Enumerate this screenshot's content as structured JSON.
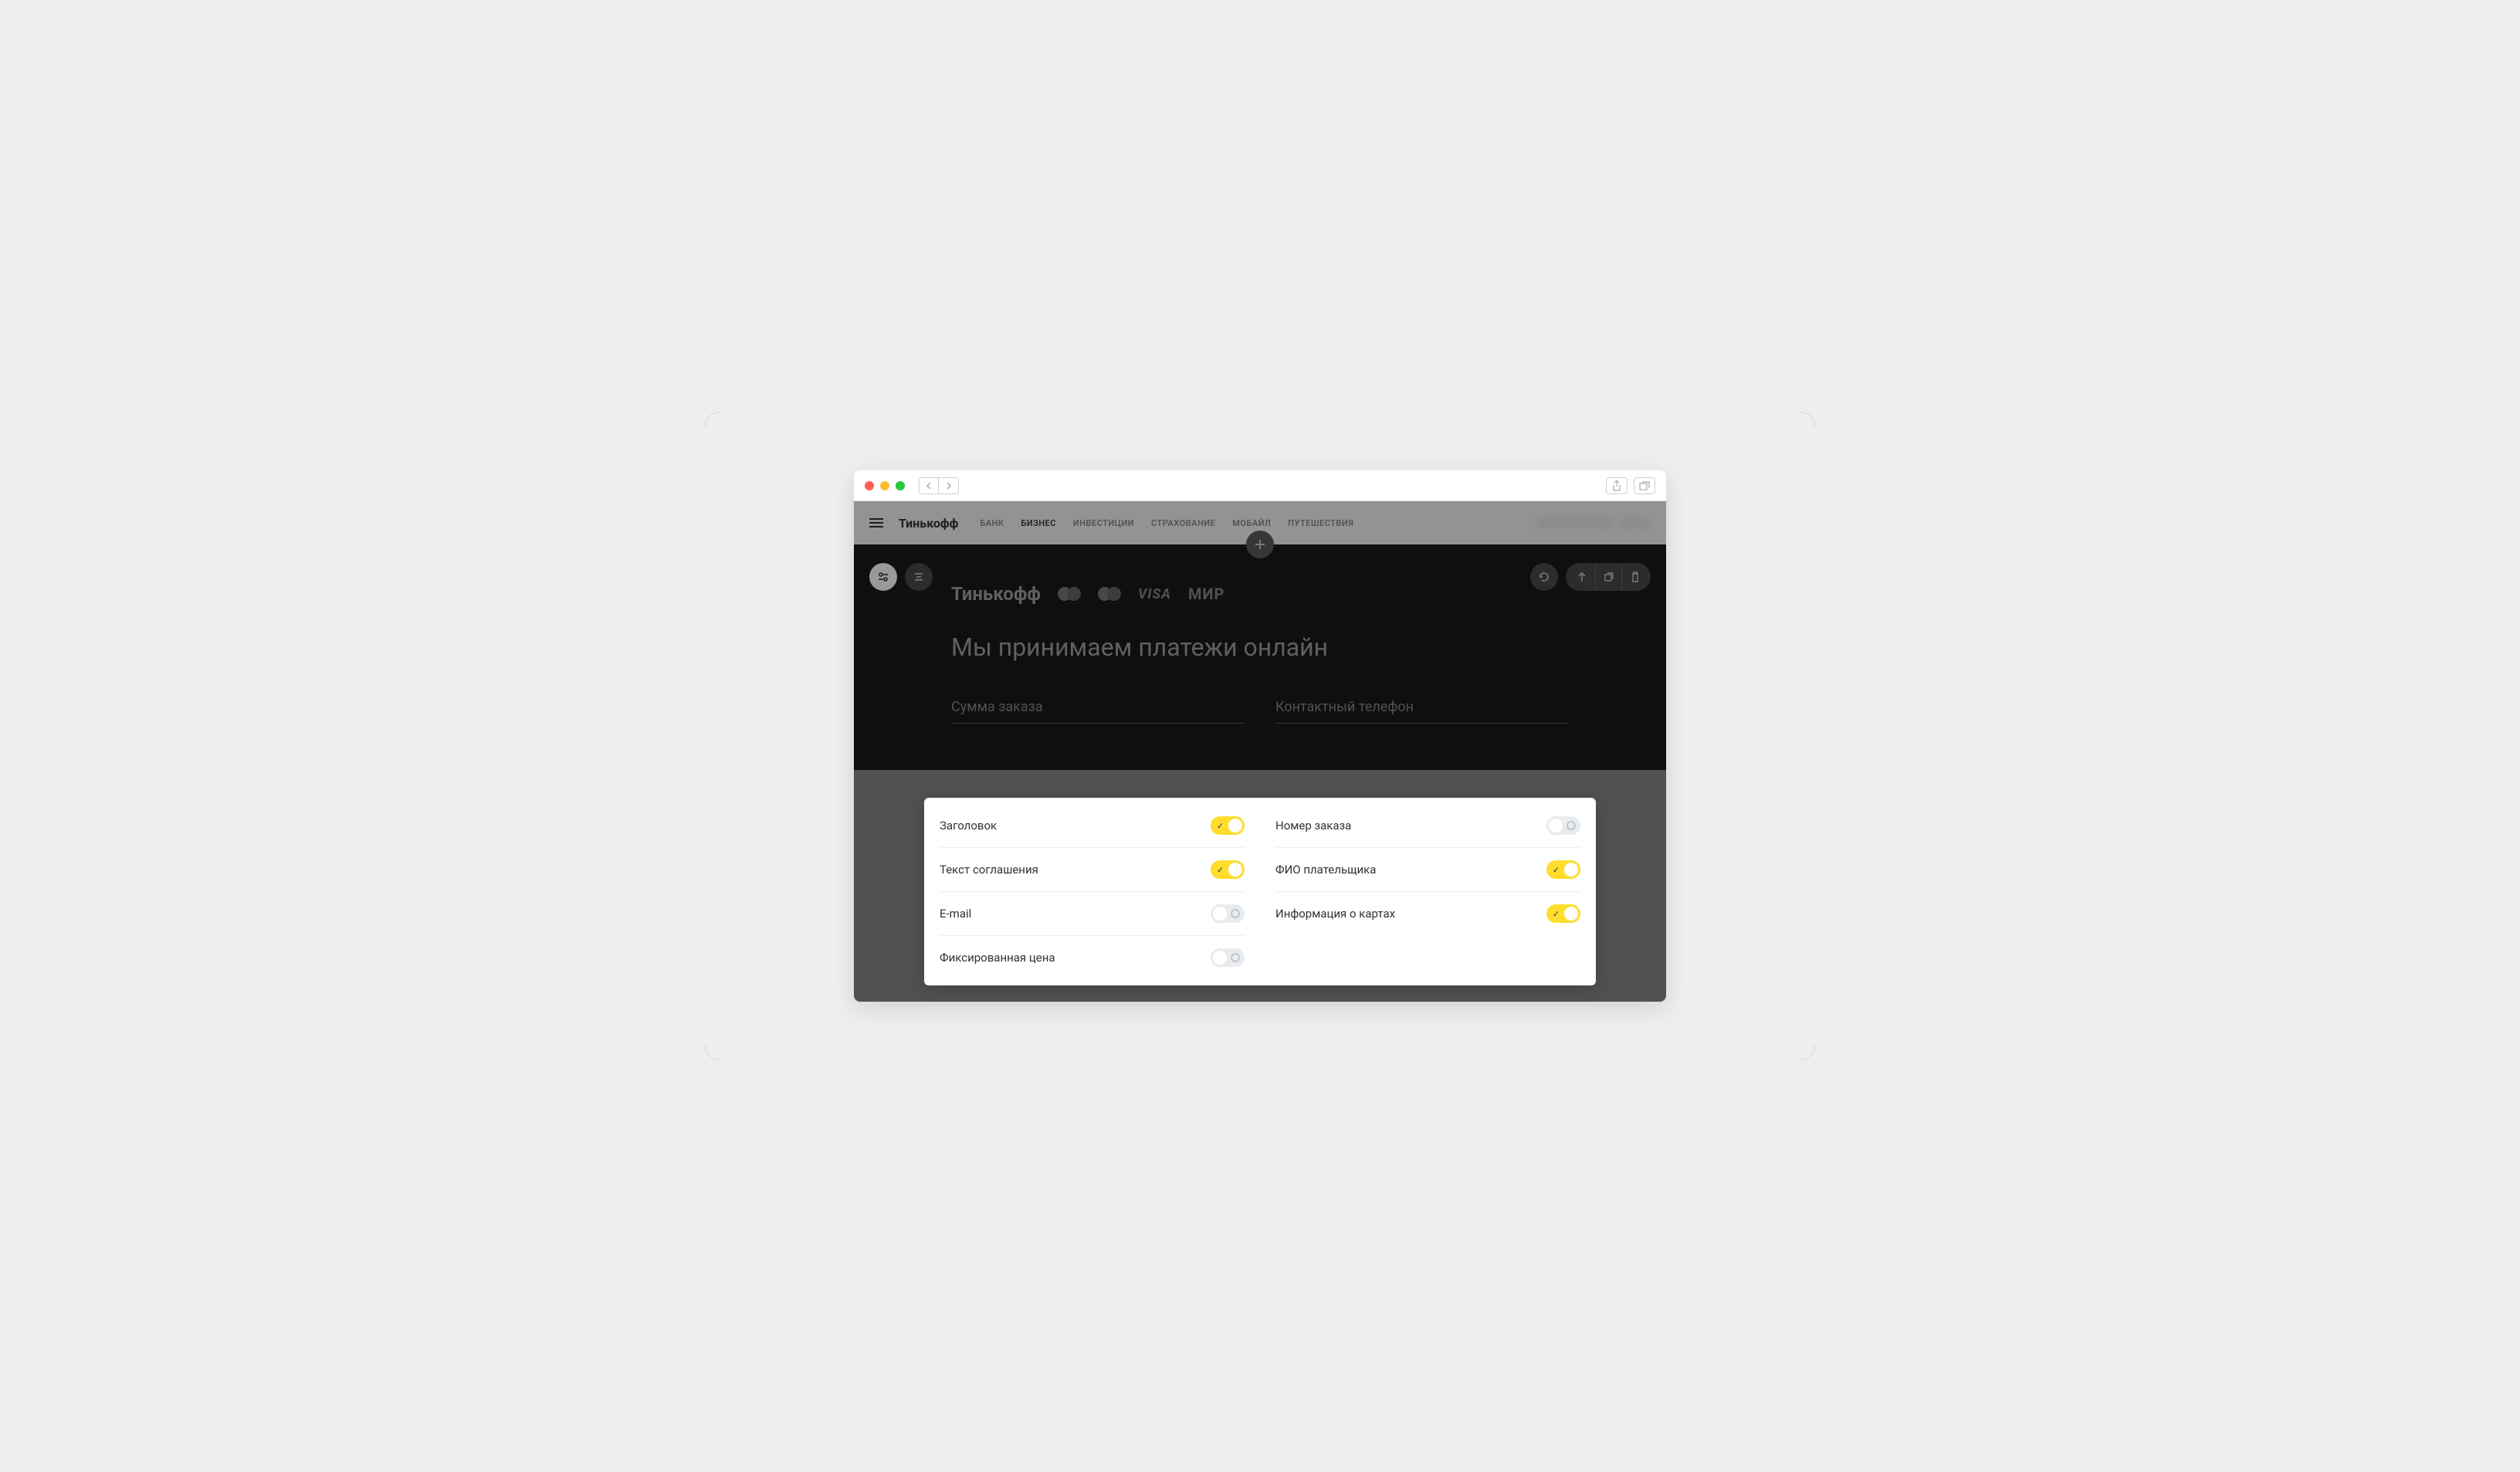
{
  "header": {
    "brand": "Тинькофф",
    "nav": [
      "БАНК",
      "БИЗНЕС",
      "ИНВЕСТИЦИИ",
      "СТРАХОВАНИЕ",
      "МОБАЙЛ",
      "ПУТЕШЕСТВИЯ"
    ],
    "active_nav_index": 1
  },
  "payment": {
    "brand": "Тинькофф",
    "card_logos": [
      "MasterCard",
      "Maestro",
      "VISA",
      "МИР"
    ],
    "title": "Мы принимаем платежи онлайн",
    "field1_placeholder": "Сумма заказа",
    "field2_placeholder": "Контактный телефон"
  },
  "settings": {
    "left": [
      {
        "label": "Заголовок",
        "on": true
      },
      {
        "label": "Текст соглашения",
        "on": true
      },
      {
        "label": "E-mail",
        "on": false
      },
      {
        "label": "Фиксированная цена",
        "on": false
      }
    ],
    "right": [
      {
        "label": "Номер заказа",
        "on": false
      },
      {
        "label": "ФИО плательщика",
        "on": true
      },
      {
        "label": "Информация о картах",
        "on": true
      }
    ]
  }
}
